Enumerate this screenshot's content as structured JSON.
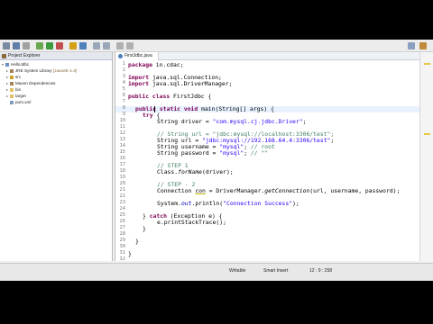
{
  "explorer": {
    "tab_label": "Project Explorer",
    "tree": [
      {
        "label": "HelloJdbc",
        "sub": "",
        "icon": "project-icon"
      },
      {
        "label": "JRE System Library",
        "sub": "[JavaSE-1.8]",
        "icon": "library-icon"
      },
      {
        "label": "src",
        "sub": "",
        "icon": "source-folder-icon"
      },
      {
        "label": "Maven Dependencies",
        "sub": "",
        "icon": "library-icon"
      },
      {
        "label": "bin",
        "sub": "",
        "icon": "folder-icon"
      },
      {
        "label": "target",
        "sub": "",
        "icon": "folder-icon"
      },
      {
        "label": "pom.xml",
        "sub": "",
        "icon": "xml-file-icon"
      }
    ]
  },
  "editor": {
    "tab_label": "FirstJdbc.java",
    "line_numbers": [
      "1",
      "2",
      "3",
      "4",
      "5",
      "6",
      "7",
      "8",
      "9",
      "10",
      "11",
      "12",
      "13",
      "14",
      "15",
      "16",
      "17",
      "18",
      "19",
      "20",
      "21",
      "22",
      "23",
      "24",
      "25",
      "26",
      "27",
      "28",
      "29",
      "30",
      "31",
      "32"
    ],
    "code": {
      "l1_kw": "package",
      "l1_rest": " in.cdac;",
      "l3_kw": "import",
      "l3_rest": " java.sql.Connection;",
      "l4_kw": "import",
      "l4_rest": " java.sql.DriverManager;",
      "l6_kw": "public class",
      "l6_rest": " FirstJdbc {",
      "l8_kw": "public static void",
      "l8_rest": " main(String[] args) {",
      "l9_kw": "try",
      "l9_rest": " {",
      "l10_a": "String driver = ",
      "l10_str": "\"com.mysql.cj.jdbc.Driver\"",
      "l10_b": ";",
      "l12_cm": "// String url = \"jdbc:mysql://localhost:3306/test\";",
      "l13_a": "String url = ",
      "l13_str": "\"jdbc:mysql://192.168.64.4:3306/test\"",
      "l13_b": ";",
      "l14_a": "String username = ",
      "l14_str": "\"mysql\"",
      "l14_b": "; ",
      "l14_cm": "// root",
      "l15_a": "String password = ",
      "l15_str": "\"mysql\"",
      "l15_b": "; ",
      "l15_cm": "// \"\"",
      "l17_cm": "// STEP 1",
      "l18_a": "Class.",
      "l18_itl": "forName",
      "l18_b": "(driver);",
      "l20_cm": "// STEP - 2",
      "l21_a": "Connection ",
      "l21_ul": "con",
      "l21_b": " = DriverManager.",
      "l21_itl": "getConnection",
      "l21_c": "(url, username, password);",
      "l23_a": "System.",
      "l23_fld": "out",
      "l23_b": ".println(",
      "l23_str": "\"Connection Success\"",
      "l23_c": ");",
      "l25_a": "} ",
      "l25_kw": "catch",
      "l25_b": " (Exception e) {",
      "l26": "e.printStackTrace();",
      "l27": "}",
      "l29": "}",
      "l31": "}"
    }
  },
  "status": {
    "writable": "Writable",
    "insert_mode": "Smart Insert",
    "position": "12 : 9 : 258"
  },
  "colors": {
    "keyword": "#7f0055",
    "string": "#2a00ff",
    "comment": "#3f7f5f",
    "field": "#0000c0"
  }
}
